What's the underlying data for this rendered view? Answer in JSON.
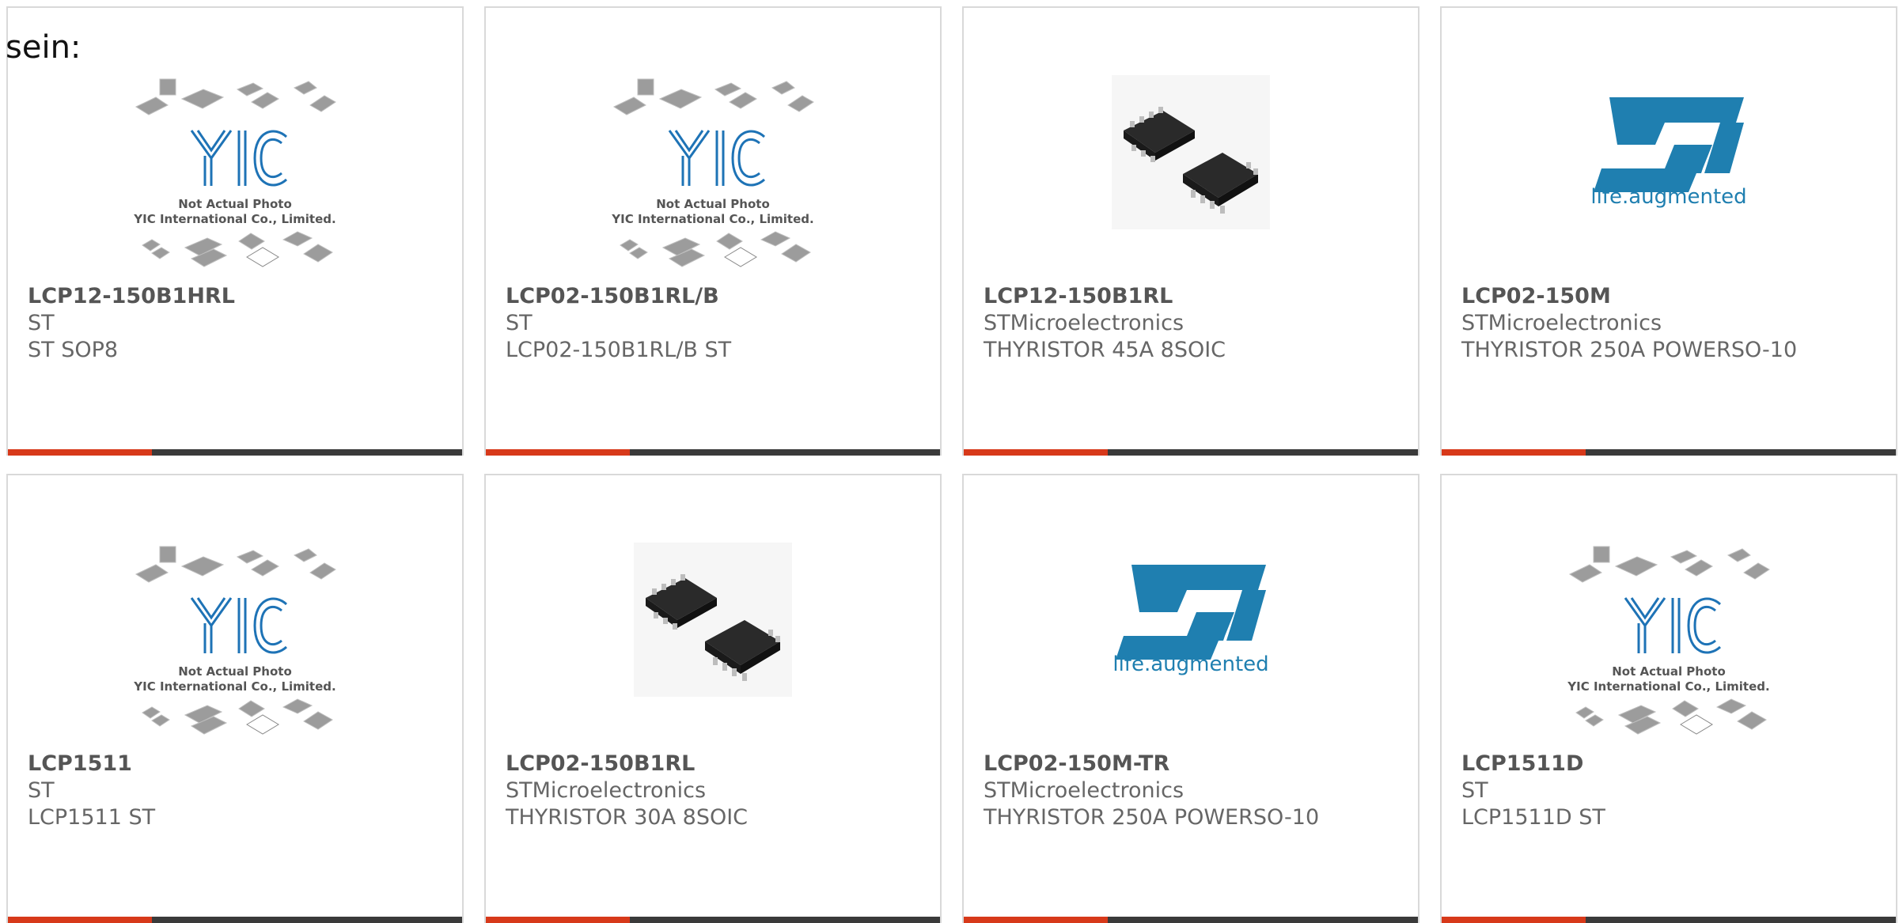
{
  "intro_text": "sein:",
  "products": [
    {
      "part": "LCP12-150B1HRL",
      "manufacturer": "ST",
      "description": "ST SOP8",
      "image": "yic-placeholder-icon",
      "placeholder_line1": "Not Actual Photo",
      "placeholder_line2": "YIC International Co., Limited.",
      "logo_text": "YIC"
    },
    {
      "part": "LCP02-150B1RL/B",
      "manufacturer": "ST",
      "description": "LCP02-150B1RL/B ST",
      "image": "yic-placeholder-icon",
      "placeholder_line1": "Not Actual Photo",
      "placeholder_line2": "YIC International Co., Limited.",
      "logo_text": "YIC"
    },
    {
      "part": "LCP12-150B1RL",
      "manufacturer": "STMicroelectronics",
      "description": "THYRISTOR 45A 8SOIC",
      "image": "soic-chip-photo"
    },
    {
      "part": "LCP02-150M",
      "manufacturer": "STMicroelectronics",
      "description": "THYRISTOR 250A POWERSO-10",
      "image": "st-logo",
      "st_tagline": "life.augmented"
    },
    {
      "part": "LCP1511",
      "manufacturer": "ST",
      "description": "LCP1511 ST",
      "image": "yic-placeholder-icon",
      "placeholder_line1": "Not Actual Photo",
      "placeholder_line2": "YIC International Co., Limited.",
      "logo_text": "YIC"
    },
    {
      "part": "LCP02-150B1RL",
      "manufacturer": "STMicroelectronics",
      "description": "THYRISTOR 30A 8SOIC",
      "image": "soic-chip-photo"
    },
    {
      "part": "LCP02-150M-TR",
      "manufacturer": "STMicroelectronics",
      "description": "THYRISTOR 250A POWERSO-10",
      "image": "st-logo",
      "st_tagline": "life.augmented"
    },
    {
      "part": "LCP1511D",
      "manufacturer": "ST",
      "description": "LCP1511D ST",
      "image": "yic-placeholder-icon",
      "placeholder_line1": "Not Actual Photo",
      "placeholder_line2": "YIC International Co., Limited.",
      "logo_text": "YIC"
    }
  ],
  "colors": {
    "accent": "#d7391a",
    "bar_dark": "#3a3a3a",
    "st_blue": "#1f7fb0",
    "yic_blue": "#1e73b6"
  }
}
